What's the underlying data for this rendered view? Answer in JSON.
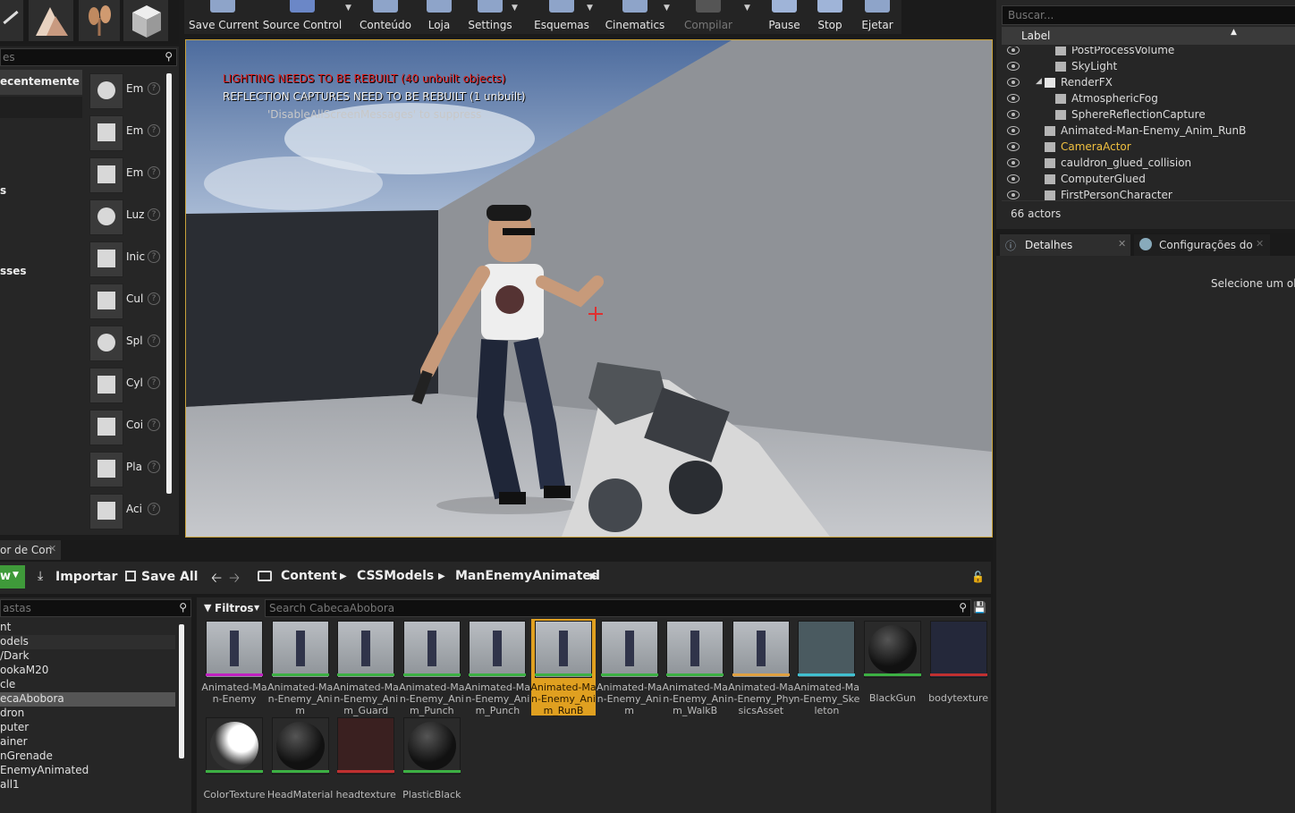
{
  "toolbar": {
    "buttons": [
      {
        "label": "Save Current",
        "icon": "save-icon"
      },
      {
        "label": "Source Control",
        "icon": "source-control-icon"
      },
      {
        "label": "Conteúdo",
        "icon": "content-icon"
      },
      {
        "label": "Loja",
        "icon": "marketplace-icon"
      },
      {
        "label": "Settings",
        "icon": "settings-icon"
      },
      {
        "label": "Esquemas",
        "icon": "blueprints-icon"
      },
      {
        "label": "Cinematics",
        "icon": "cinematics-icon"
      },
      {
        "label": "Compilar",
        "icon": "compile-icon"
      },
      {
        "label": "Pause",
        "icon": "pause-icon"
      },
      {
        "label": "Stop",
        "icon": "stop-icon"
      },
      {
        "label": "Ejetar",
        "icon": "eject-icon"
      }
    ]
  },
  "modes": {
    "search_placeholder": "es",
    "categories": [
      {
        "label": "ecentemente"
      },
      {
        "label": "s"
      },
      {
        "label": "sses"
      }
    ],
    "items": [
      {
        "label": "Em",
        "icon": "empty-actor-icon"
      },
      {
        "label": "Em",
        "icon": "empty-character-icon"
      },
      {
        "label": "Em",
        "icon": "empty-pawn-icon"
      },
      {
        "label": "Luz",
        "icon": "point-light-icon"
      },
      {
        "label": "Inic",
        "icon": "player-start-icon"
      },
      {
        "label": "Cul",
        "icon": "cube-icon"
      },
      {
        "label": "Spl",
        "icon": "sphere-icon"
      },
      {
        "label": "Cyl",
        "icon": "cylinder-icon"
      },
      {
        "label": "Coi",
        "icon": "cone-icon"
      },
      {
        "label": "Pla",
        "icon": "plane-icon"
      },
      {
        "label": "Aci",
        "icon": "box-trigger-icon"
      }
    ]
  },
  "viewport": {
    "warning_1": "LIGHTING NEEDS TO BE REBUILT (40 unbuilt objects)",
    "warning_2": "REFLECTION CAPTURES NEED TO BE REBUILT (1 unbuilt)",
    "warning_3": "'DisableAllScreenMessages' to suppress"
  },
  "outliner": {
    "search_placeholder": "Buscar...",
    "column_label": "Label",
    "rows": [
      {
        "label": "PostProcessVolume",
        "indent": 2
      },
      {
        "label": "SkyLight",
        "indent": 2
      },
      {
        "label": "RenderFX",
        "indent": 1
      },
      {
        "label": "AtmosphericFog",
        "indent": 2
      },
      {
        "label": "SphereReflectionCapture",
        "indent": 2
      },
      {
        "label": "Animated-Man-Enemy_Anim_RunB",
        "indent": 1
      },
      {
        "label": "CameraActor",
        "indent": 1
      },
      {
        "label": "cauldron_glued_collision",
        "indent": 1
      },
      {
        "label": "ComputerGlued",
        "indent": 1
      },
      {
        "label": "FirstPersonCharacter",
        "indent": 1
      }
    ],
    "count": "66 actors"
  },
  "details": {
    "tab_details": "Detalhes",
    "tab_world_settings": "Configurações do",
    "empty_message": "Selecione um obje"
  },
  "content_browser": {
    "tab": "or de Con",
    "add_new": "w",
    "import": "Importar",
    "save_all": "Save All",
    "path": [
      "Content",
      "CSSModels",
      "ManEnemyAnimated"
    ],
    "folder_search_placeholder": "astas",
    "filters": "Filtros",
    "asset_search_placeholder": "Search CabecaAbobora",
    "folders": [
      "nt",
      "odels",
      "/Dark",
      "ookaM20",
      "cle",
      "ecaAbobora",
      "dron",
      "puter",
      "ainer",
      "nGrenade",
      "EnemyAnimated",
      "all1"
    ],
    "selected_folder_index": 5,
    "assets_row1": [
      {
        "name": "Animated-Man-Enemy",
        "color": "#c020c0"
      },
      {
        "name": "Animated-Man-Enemy_Anim",
        "color": "#3cb043"
      },
      {
        "name": "Animated-Man-Enemy_Anim_Guard",
        "color": "#3cb043"
      },
      {
        "name": "Animated-Man-Enemy_Anim_Punch",
        "color": "#3cb043"
      },
      {
        "name": "Animated-Man-Enemy_Anim_Punch",
        "color": "#3cb043"
      },
      {
        "name": "Animated-Man-Enemy_Anim_RunB",
        "color": "#3cb043"
      },
      {
        "name": "Animated-Man-Enemy_Anim",
        "color": "#3cb043"
      },
      {
        "name": "Animated-Man-Enemy_Anim_WalkB",
        "color": "#3cb043"
      },
      {
        "name": "Animated-Man-Enemy_PhysicsAsset",
        "color": "#e0a040"
      },
      {
        "name": "Animated-Man-Enemy_Skeleton",
        "color": "#40c0d0"
      },
      {
        "name": "BlackGun",
        "color": "#3cb043"
      },
      {
        "name": "bodytexture",
        "color": "#c03030"
      }
    ],
    "assets_row2": [
      {
        "name": "ColorTexture",
        "color": "#3cb043"
      },
      {
        "name": "HeadMaterial",
        "color": "#3cb043"
      },
      {
        "name": "headtexture",
        "color": "#c03030"
      },
      {
        "name": "PlasticBlack",
        "color": "#3cb043"
      }
    ],
    "selected_asset_index": 5
  }
}
